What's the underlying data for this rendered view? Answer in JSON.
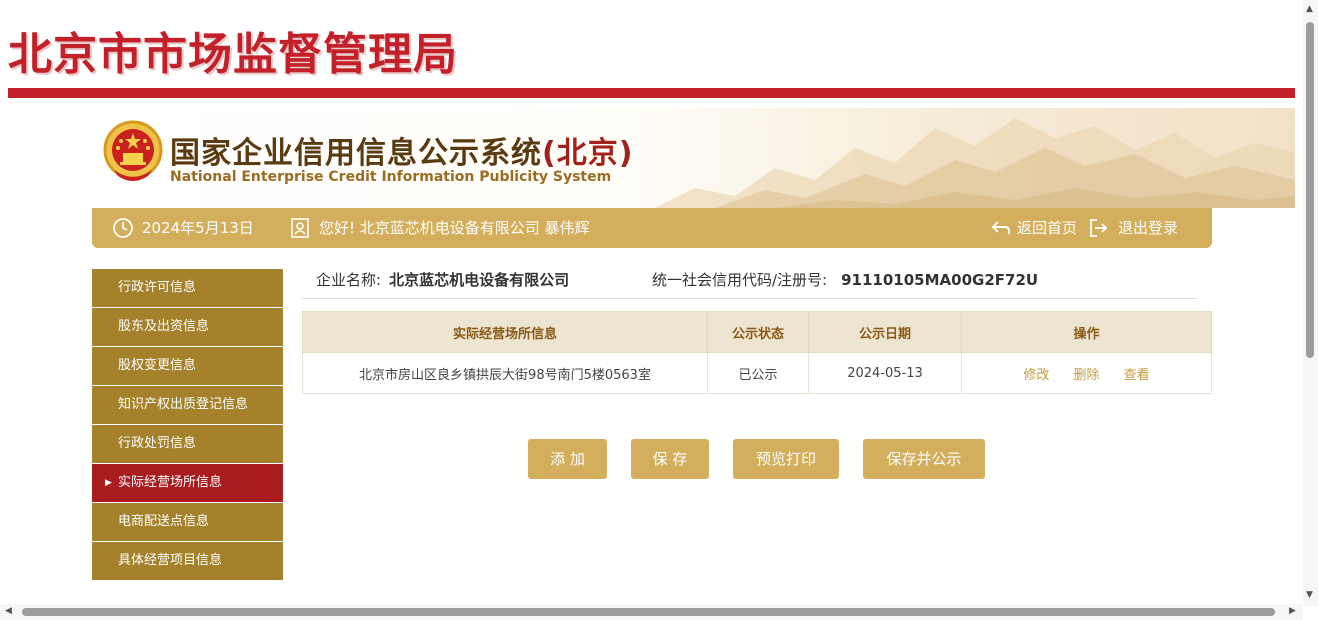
{
  "header": {
    "title": "北京市市场监督管理局"
  },
  "banner": {
    "title_cn": "国家企业信用信息公示系统",
    "title_region": "(北京)",
    "title_en": "National Enterprise Credit Information Publicity System"
  },
  "infobar": {
    "date": "2024年5月13日",
    "greeting": "您好!  北京蓝芯机电设备有限公司  暴伟辉",
    "home": "返回首页",
    "logout": "退出登录"
  },
  "sidebar": {
    "items": [
      {
        "label": "行政许可信息"
      },
      {
        "label": "股东及出资信息"
      },
      {
        "label": "股权变更信息"
      },
      {
        "label": "知识产权出质登记信息"
      },
      {
        "label": "行政处罚信息"
      },
      {
        "label": "实际经营场所信息",
        "active": true
      },
      {
        "label": "电商配送点信息"
      },
      {
        "label": "具体经营项目信息"
      }
    ]
  },
  "company": {
    "name_label": "企业名称:",
    "name": "北京蓝芯机电设备有限公司",
    "code_label": "统一社会信用代码/注册号:",
    "code": "91110105MA00G2F72U"
  },
  "table": {
    "headers": [
      "实际经营场所信息",
      "公示状态",
      "公示日期",
      "操作"
    ],
    "rows": [
      {
        "address": "北京市房山区良乡镇拱辰大街98号南门5楼0563室",
        "status": "已公示",
        "date": "2024-05-13",
        "ops": [
          "修改",
          "删除",
          "查看"
        ]
      }
    ]
  },
  "buttons": {
    "add": "添 加",
    "save": "保 存",
    "preview": "预览打印",
    "save_publish": "保存并公示"
  },
  "colors": {
    "brand_red": "#c4202a",
    "gold": "#d3ae5c",
    "side_gold": "#a5812b",
    "side_active": "#a91d1f"
  }
}
